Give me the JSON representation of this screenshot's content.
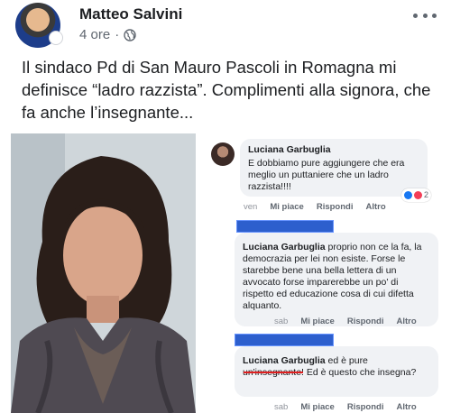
{
  "post": {
    "author": "Matteo Salvini",
    "time": "4 ore",
    "separator": "·",
    "caption": "Il sindaco Pd di San Mauro Pascoli in Romagna mi definisce “ladro razzista”. Complimenti alla signora, che fa anche l’insegnante..."
  },
  "comments": [
    {
      "name": "Luciana Garbuglia",
      "text": "E dobbiamo pure aggiungere che era meglio un puttaniere che un ladro razzista!!!!",
      "reactions": "2",
      "day": "ven",
      "like": "Mi piace",
      "reply": "Rispondi",
      "more": "Altro"
    },
    {
      "tag": "Luciana Garbuglia",
      "text": "proprio non ce la fa, la democrazia per lei non esiste. Forse le starebbe bene una bella lettera di un avvocato forse imparerebbe un po' di rispetto ed educazione cosa di cui difetta alquanto.",
      "day": "sab",
      "like": "Mi piace",
      "reply": "Rispondi",
      "more": "Altro"
    },
    {
      "tag": "Luciana Garbuglia",
      "text": "ed è pure un'insegnante! Ed è questo che insegna?",
      "day": "sab",
      "like": "Mi piace",
      "reply": "Rispondi",
      "more": "Altro"
    }
  ],
  "icons": [
    "globe-icon",
    "more-icon"
  ],
  "colors": {
    "redaction": "#1c52c9",
    "underline": "#e02020",
    "bubble": "#f0f2f5"
  }
}
